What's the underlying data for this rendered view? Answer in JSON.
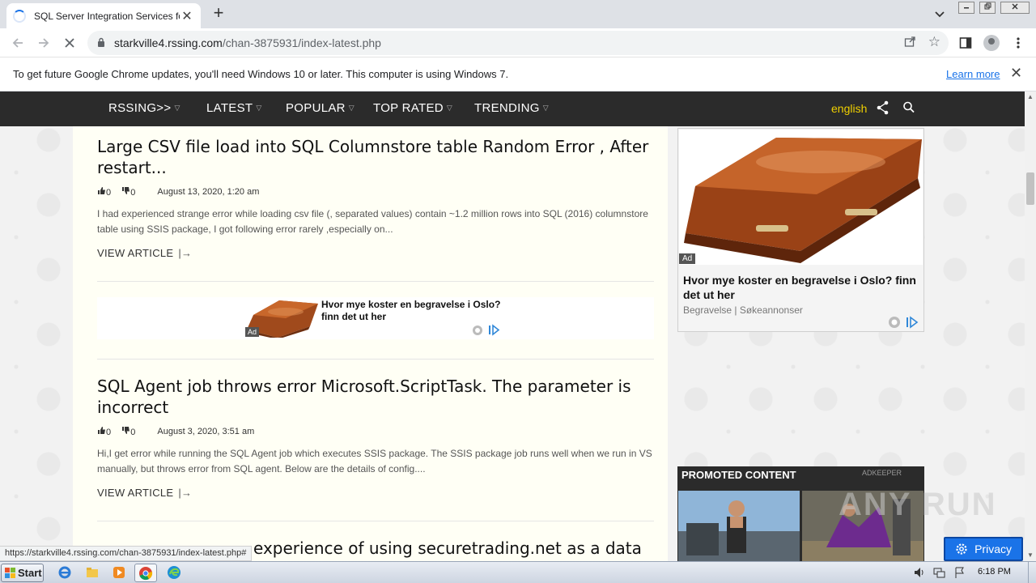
{
  "browser": {
    "tab_title": "SQL Server Integration Services forum",
    "new_tab_symbol": "+",
    "tab_close_symbol": "✕",
    "url_domain": "starkville4.rssing.com",
    "url_path": "/chan-3875931/index-latest.php",
    "infobar_message": "To get future Google Chrome updates, you'll need Windows 10 or later. This computer is using Windows 7.",
    "infobar_link": "Learn more",
    "status_url": "https://starkville4.rssing.com/chan-3875931/index-latest.php#"
  },
  "site_nav": {
    "items": [
      {
        "label": "RSSING>>"
      },
      {
        "label": "LATEST"
      },
      {
        "label": "POPULAR"
      },
      {
        "label": "TOP RATED"
      },
      {
        "label": "TRENDING"
      }
    ],
    "language": "english"
  },
  "articles": [
    {
      "title": "Large CSV file load into SQL Columnstore table Random Error , After restart...",
      "likes": "0",
      "dislikes": "0",
      "date": "August 13, 2020, 1:20 am",
      "excerpt": "I had experienced strange error while loading csv file (, separated values) contain ~1.2 million rows into SQL (2016) columnstore table using SSIS package, I got following error rarely ,especially on...",
      "link": "VIEW ARTICLE"
    },
    {
      "title": "SQL Agent job throws error Microsoft.ScriptTask. The parameter is incorrect",
      "likes": "0",
      "dislikes": "0",
      "date": "August 3, 2020, 3:51 am",
      "excerpt": "Hi,I get error while running the SQL Agent job which executes SSIS package. The SSIS package job runs well when we run in VS manually, but throws error from SQL agent. Below are the details of config....",
      "link": "VIEW ARTICLE"
    },
    {
      "title_visible": "experience of using securetrading.net as a data"
    }
  ],
  "inline_ad": {
    "headline": "Hvor mye koster en begravelse i Oslo? finn det ut her",
    "badge": "Ad"
  },
  "side_ad": {
    "headline": "Hvor mye koster en begravelse i Oslo? finn det ut her",
    "sponsor": "Begravelse | Søkeannonser",
    "badge": "Ad"
  },
  "promoted": {
    "title": "PROMOTED CONTENT",
    "brand": "ADKEEPER"
  },
  "watermark": "ANY RUN",
  "privacy_button": "Privacy",
  "taskbar": {
    "start_label": "Start",
    "clock": "6:18 PM"
  },
  "colors": {
    "nav_bg": "#2b2b2b",
    "lang": "#f0d000",
    "content_bg": "#fffff5",
    "privacy_bg": "#1a73e8",
    "link_blue": "#1a73e8"
  }
}
